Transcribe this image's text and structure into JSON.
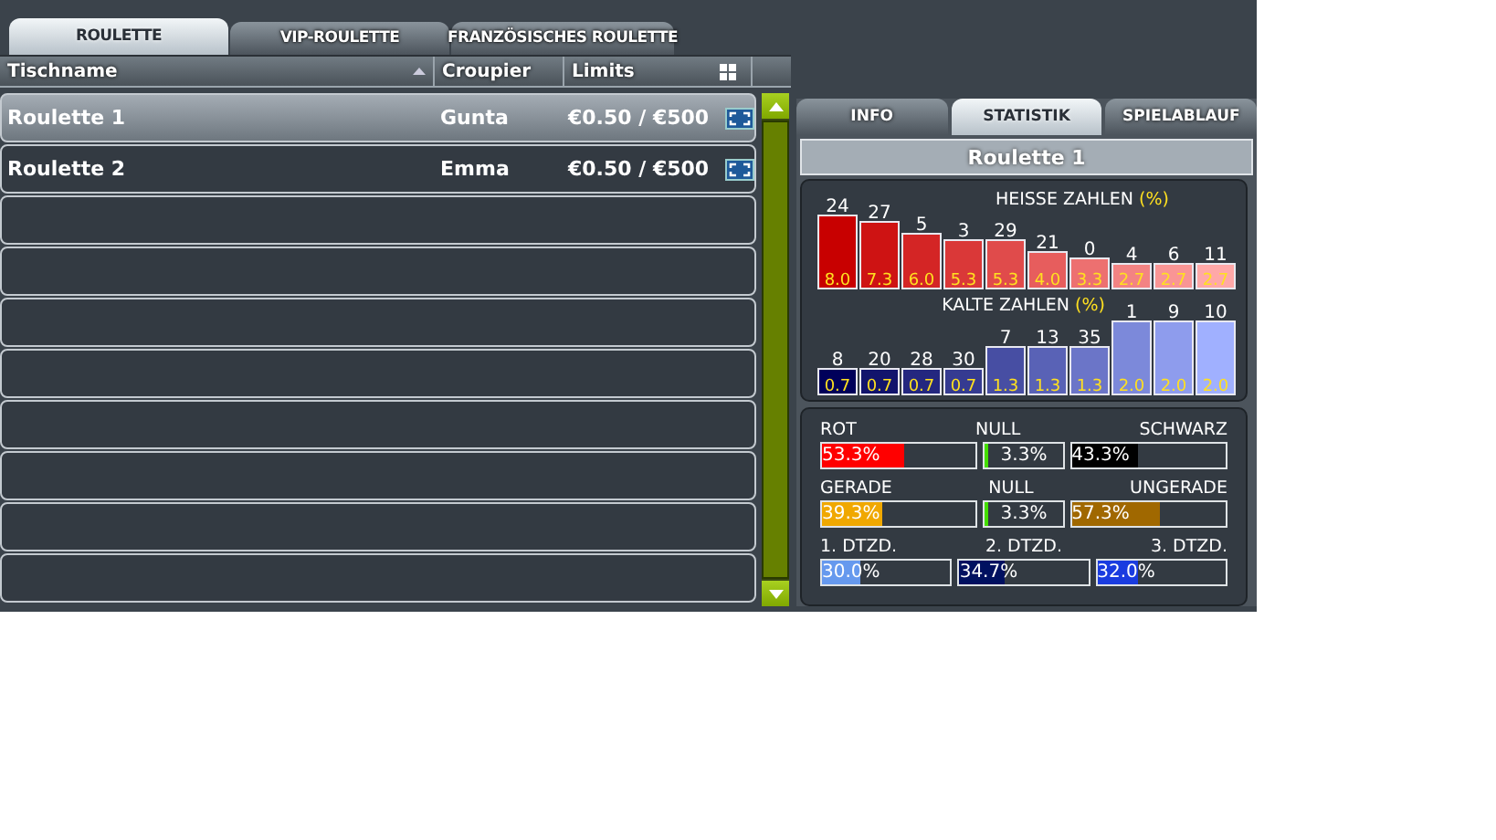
{
  "tabs": [
    {
      "label": "ROULETTE",
      "selected": true
    },
    {
      "label": "VIP-ROULETTE",
      "selected": false
    },
    {
      "label": "FRANZÖSISCHES ROULETTE",
      "selected": false
    }
  ],
  "table": {
    "columns": [
      {
        "label": "Tischname",
        "sorted": true
      },
      {
        "label": "Croupier",
        "sorted": false
      },
      {
        "label": "Limits",
        "sorted": false
      }
    ],
    "rows": [
      {
        "name": "Roulette 1",
        "croupier": "Gunta",
        "limits": "€0.50 / €500",
        "selected": true
      },
      {
        "name": "Roulette 2",
        "croupier": "Emma",
        "limits": "€0.50 / €500",
        "selected": false
      }
    ]
  },
  "detail": {
    "tabs": [
      {
        "label": "INFO",
        "selected": false
      },
      {
        "label": "STATISTIK",
        "selected": true
      },
      {
        "label": "SPIELABLAUF",
        "selected": false
      }
    ],
    "title": "Roulette 1",
    "hot": {
      "unit": "(%)",
      "chart_data": {
        "type": "bar",
        "title": "HEISSE ZAHLEN",
        "categories": [
          "24",
          "27",
          "5",
          "3",
          "29",
          "21",
          "0",
          "4",
          "6",
          "11"
        ],
        "values": [
          8.0,
          7.3,
          6.0,
          5.3,
          5.3,
          4.0,
          3.3,
          2.7,
          2.7,
          2.7
        ],
        "value_labels": [
          "8.0",
          "7.3",
          "6.0",
          "5.3",
          "5.3",
          "4.0",
          "3.3",
          "2.7",
          "2.7",
          "2.7"
        ]
      }
    },
    "cold": {
      "unit": "(%)",
      "chart_data": {
        "type": "bar",
        "title": "KALTE ZAHLEN",
        "categories": [
          "8",
          "20",
          "28",
          "30",
          "7",
          "13",
          "35",
          "1",
          "9",
          "10"
        ],
        "values": [
          0.7,
          0.7,
          0.7,
          0.7,
          1.3,
          1.3,
          1.3,
          2.0,
          2.0,
          2.0
        ],
        "value_labels": [
          "0.7",
          "0.7",
          "0.7",
          "0.7",
          "1.3",
          "1.3",
          "1.3",
          "2.0",
          "2.0",
          "2.0"
        ]
      }
    },
    "stats": [
      {
        "kind": "with_null",
        "segments": [
          {
            "label": "ROT",
            "value": "53.3%",
            "level": 0.533,
            "color": "#ff0000"
          },
          {
            "label": "NULL",
            "value": "3.3%",
            "level": 0.033,
            "color": "#44dd00"
          },
          {
            "label": "SCHWARZ",
            "value": "43.3%",
            "level": 0.433,
            "color": "#000000"
          }
        ]
      },
      {
        "kind": "with_null",
        "segments": [
          {
            "label": "GERADE",
            "value": "39.3%",
            "level": 0.393,
            "color": "#f0a800"
          },
          {
            "label": "NULL",
            "value": "3.3%",
            "level": 0.033,
            "color": "#44dd00"
          },
          {
            "label": "UNGERADE",
            "value": "57.3%",
            "level": 0.573,
            "color": "#a06800"
          }
        ]
      },
      {
        "kind": "thirds",
        "segments": [
          {
            "label": "1. DTZD.",
            "value": "30.0%",
            "level": 0.3,
            "color": "#6699ee"
          },
          {
            "label": "2. DTZD.",
            "value": "34.7%",
            "level": 0.347,
            "color": "#001060"
          },
          {
            "label": "3. DTZD.",
            "value": "32.0%",
            "level": 0.32,
            "color": "#1a3ce0"
          }
        ]
      }
    ]
  }
}
